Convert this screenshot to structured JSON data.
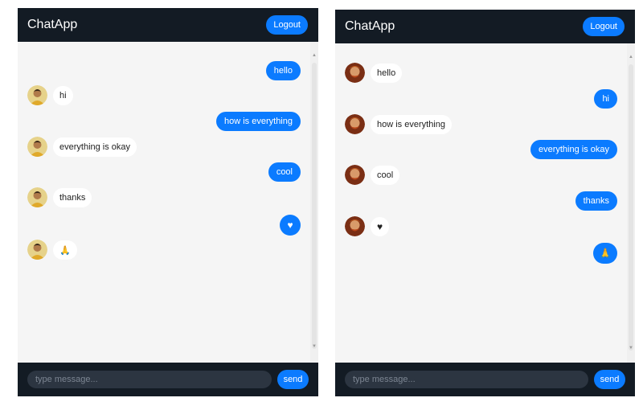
{
  "colors": {
    "accent": "#0b7bff",
    "header": "#131b24",
    "chat_bg": "#f5f5f5",
    "input_bg": "#2c3541"
  },
  "left": {
    "title": "ChatApp",
    "logout_label": "Logout",
    "input_placeholder": "type message...",
    "send_label": "send",
    "messages": [
      {
        "side": "sent",
        "text": "hello"
      },
      {
        "side": "received",
        "text": "hi"
      },
      {
        "side": "sent",
        "text": "how is everything"
      },
      {
        "side": "received",
        "text": "everything is okay"
      },
      {
        "side": "sent",
        "text": "cool"
      },
      {
        "side": "received",
        "text": "thanks"
      },
      {
        "side": "sent",
        "icon": "heart-icon",
        "text": "♥"
      },
      {
        "side": "received",
        "text": "🙏"
      }
    ]
  },
  "right": {
    "title": "ChatApp",
    "logout_label": "Logout",
    "input_placeholder": "type message...",
    "send_label": "send",
    "messages": [
      {
        "side": "received",
        "text": "hello"
      },
      {
        "side": "sent",
        "text": "hi"
      },
      {
        "side": "received",
        "text": "how is everything"
      },
      {
        "side": "sent",
        "text": "everything is okay"
      },
      {
        "side": "received",
        "text": "cool"
      },
      {
        "side": "sent",
        "text": "thanks"
      },
      {
        "side": "received",
        "icon": "heart-icon",
        "text": "♥"
      },
      {
        "side": "sent",
        "text": "🙏"
      }
    ]
  }
}
